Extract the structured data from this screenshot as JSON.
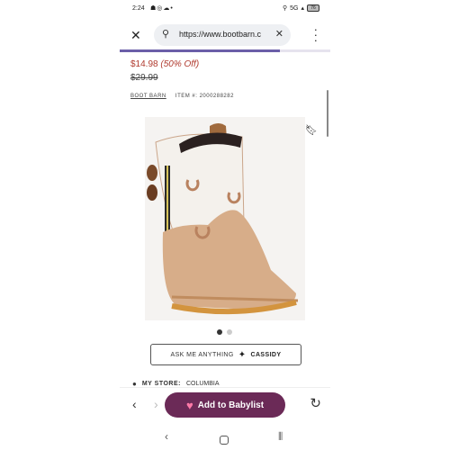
{
  "status_bar": {
    "time": "2:24",
    "network": "5G",
    "battery": "76"
  },
  "browser": {
    "url": "https://www.bootbarn.c",
    "progress_percent": 76
  },
  "product": {
    "price": "$14.98",
    "discount": "(50% Off)",
    "original_price": "$29.99",
    "brand": "BOOT BARN",
    "item_number": "ITEM #: 2000288282"
  },
  "gallery": {
    "images_total": 2,
    "active_index": 0
  },
  "ask_button": {
    "label": "ASK ME ANYTHING",
    "assistant": "CASSIDY"
  },
  "store": {
    "label": "MY STORE:",
    "value": "COLUMBIA"
  },
  "toolbar": {
    "babylist_label": "Add to Babylist"
  },
  "colors": {
    "accent": "#6b5fa8",
    "price_red": "#b03a2e",
    "babylist_button": "#6b2a57"
  }
}
